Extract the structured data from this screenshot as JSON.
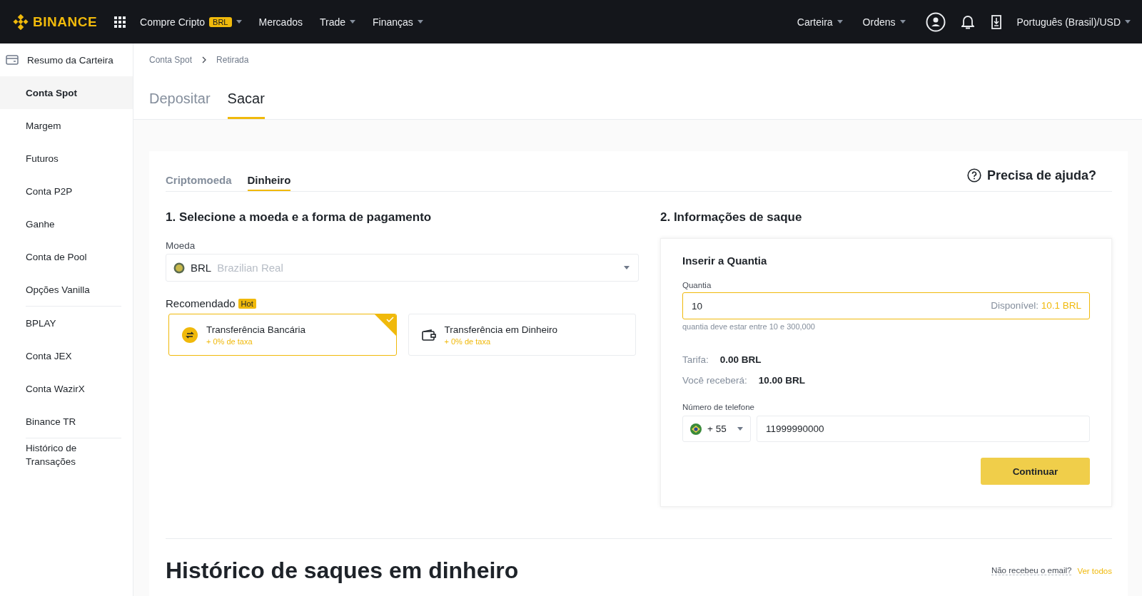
{
  "header": {
    "logo": "BINANCE",
    "nav": [
      {
        "label": "Compre Cripto",
        "badge": "BRL",
        "dropdown": true
      },
      {
        "label": "Mercados",
        "dropdown": false
      },
      {
        "label": "Trade",
        "dropdown": true
      },
      {
        "label": "Finanças",
        "dropdown": true
      }
    ],
    "right": [
      {
        "label": "Carteira",
        "dropdown": true
      },
      {
        "label": "Ordens",
        "dropdown": true
      }
    ],
    "language": "Português (Brasil)/USD"
  },
  "sidebar": {
    "groups": [
      {
        "items": [
          {
            "label": "Resumo da Carteira",
            "selected": false
          },
          {
            "label": "Conta Spot",
            "selected": true
          },
          {
            "label": "Margem",
            "selected": false
          },
          {
            "label": "Futuros",
            "selected": false
          },
          {
            "label": "Conta P2P",
            "selected": false
          },
          {
            "label": "Ganhe",
            "selected": false
          },
          {
            "label": "Conta de Pool",
            "selected": false
          },
          {
            "label": "Opções Vanilla",
            "selected": false
          }
        ]
      },
      {
        "items": [
          {
            "label": "BPLAY",
            "selected": false
          },
          {
            "label": "Conta JEX",
            "selected": false
          },
          {
            "label": "Conta WazirX",
            "selected": false
          },
          {
            "label": "Binance TR",
            "selected": false
          }
        ]
      },
      {
        "items": [
          {
            "label": "Histórico de Transações",
            "selected": false
          }
        ]
      }
    ]
  },
  "breadcrumb": [
    "Conta Spot",
    "Retirada"
  ],
  "page_tabs": [
    {
      "label": "Depositar",
      "selected": false
    },
    {
      "label": "Sacar",
      "selected": true
    }
  ],
  "card": {
    "tabs": [
      {
        "label": "Criptomoeda",
        "selected": false
      },
      {
        "label": "Dinheiro",
        "selected": true
      }
    ],
    "help": "Precisa de ajuda?",
    "step1": {
      "title": "1. Selecione a moeda e a forma de pagamento",
      "currency_label": "Moeda",
      "currency_code": "BRL",
      "currency_name": "Brazilian Real",
      "recommended": "Recomendado",
      "hot": "Hot",
      "methods": [
        {
          "kind": "bank",
          "name": "Transferência Bancária",
          "fee": "+ 0% de taxa",
          "selected": true
        },
        {
          "kind": "cash",
          "name": "Transferência em Dinheiro",
          "fee": "+ 0% de taxa",
          "selected": false
        }
      ]
    },
    "step2": {
      "title": "2. Informações de saque",
      "panel_title": "Inserir a Quantia",
      "amount_label": "Quantia",
      "amount": "10",
      "available_label": "Disponível:",
      "available": "10.1 BRL",
      "hint": "quantia deve estar entre 10 e 300,000",
      "fee_label": "Tarifa:",
      "fee": "0.00 BRL",
      "receive_label": "Você receberá:",
      "receive": "10.00 BRL",
      "phone_label": "Número de telefone",
      "country_code": "+ 55",
      "phone": "11999990000",
      "submit": "Continuar"
    }
  },
  "history": {
    "title": "Histórico de saques em dinheiro",
    "email_link": "Não recebeu o email?",
    "view_all": "Ver todos"
  }
}
